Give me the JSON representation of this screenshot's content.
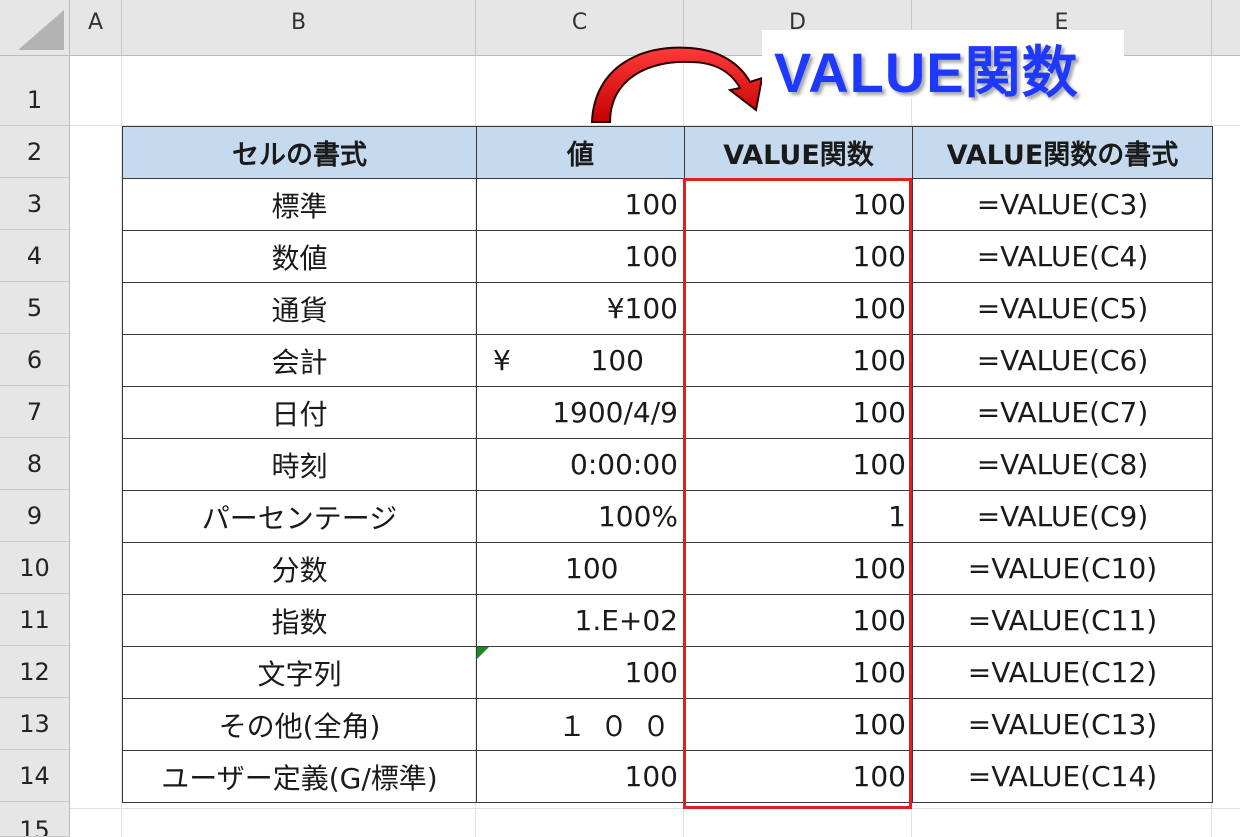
{
  "columns": [
    "A",
    "B",
    "C",
    "D",
    "E"
  ],
  "rows": [
    "1",
    "2",
    "3",
    "4",
    "5",
    "6",
    "7",
    "8",
    "9",
    "10",
    "11",
    "12",
    "13",
    "14",
    "15"
  ],
  "title": "VALUE関数",
  "table": {
    "headers": [
      "セルの書式",
      "値",
      "VALUE関数",
      "VALUE関数の書式"
    ],
    "rows": [
      {
        "format": "標準",
        "value": "100",
        "result": "100",
        "formula": "=VALUE(C3)"
      },
      {
        "format": "数値",
        "value": "100",
        "result": "100",
        "formula": "=VALUE(C4)"
      },
      {
        "format": "通貨",
        "value": "¥100",
        "result": "100",
        "formula": "=VALUE(C5)"
      },
      {
        "format": "会計",
        "value_symbol": "¥",
        "value": "100",
        "result": "100",
        "formula": "=VALUE(C6)"
      },
      {
        "format": "日付",
        "value": "1900/4/9",
        "result": "100",
        "formula": "=VALUE(C7)"
      },
      {
        "format": "時刻",
        "value": "0:00:00",
        "result": "100",
        "formula": "=VALUE(C8)"
      },
      {
        "format": "パーセンテージ",
        "value": "100%",
        "result": "1",
        "formula": "=VALUE(C9)"
      },
      {
        "format": "分数",
        "value": "100",
        "result": "100",
        "formula": "=VALUE(C10)"
      },
      {
        "format": "指数",
        "value": "1.E+02",
        "result": "100",
        "formula": "=VALUE(C11)"
      },
      {
        "format": "文字列",
        "value": "100",
        "result": "100",
        "formula": "=VALUE(C12)"
      },
      {
        "format": "その他(全角)",
        "value": "１００",
        "result": "100",
        "formula": "=VALUE(C13)"
      },
      {
        "format": "ユーザー定義(G/標準)",
        "value": "100",
        "result": "100",
        "formula": "=VALUE(C14)"
      }
    ]
  },
  "colors": {
    "header_fill": "#c5daee",
    "highlight_border": "#e02020",
    "title_color": "#1f38ff",
    "error_indicator": "#1e8a1e"
  }
}
